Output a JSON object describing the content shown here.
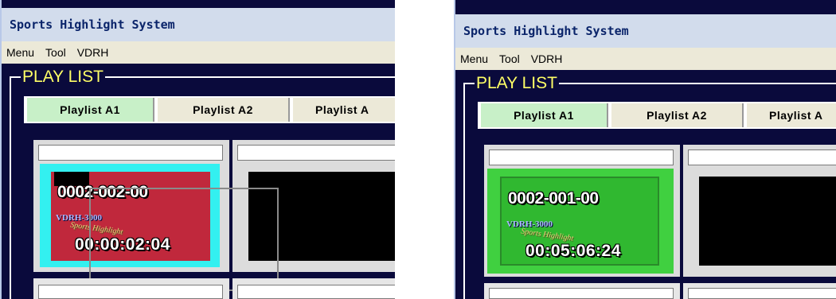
{
  "windows": [
    {
      "title": "Sports Highlight System",
      "menu": [
        "Menu",
        "Tool",
        "VDRH"
      ],
      "playlist_heading": "PLAY LIST",
      "tabs": [
        "Playlist A1",
        "Playlist A2",
        "Playlist A"
      ],
      "active_tab": 0,
      "thumbnail": {
        "code": "0002-002-00",
        "subtitle": "VDRH-3000",
        "brand": "Sports Highlight",
        "timecode": "00:00:02:04",
        "highlight_color": "#33f0f0",
        "fill_color": "#c0283c",
        "state": "dragging"
      }
    },
    {
      "title": "Sports Highlight System",
      "menu": [
        "Menu",
        "Tool",
        "VDRH"
      ],
      "playlist_heading": "PLAY LIST",
      "tabs": [
        "Playlist A1",
        "Playlist A2",
        "Playlist A"
      ],
      "active_tab": 0,
      "thumbnail": {
        "code": "0002-001-00",
        "subtitle": "VDRH-3000",
        "brand": "Sports Highlight",
        "timecode": "00:05:06:24",
        "highlight_color": "#40d040",
        "fill_color": "#30b830",
        "state": "selected"
      }
    }
  ],
  "colors": {
    "title_bar_bg": "#d2dcec",
    "title_text": "#0a246a",
    "panel_bg": "#0a0a3c",
    "heading_text": "#ffff66",
    "active_tab_bg": "#c8f0c8"
  }
}
